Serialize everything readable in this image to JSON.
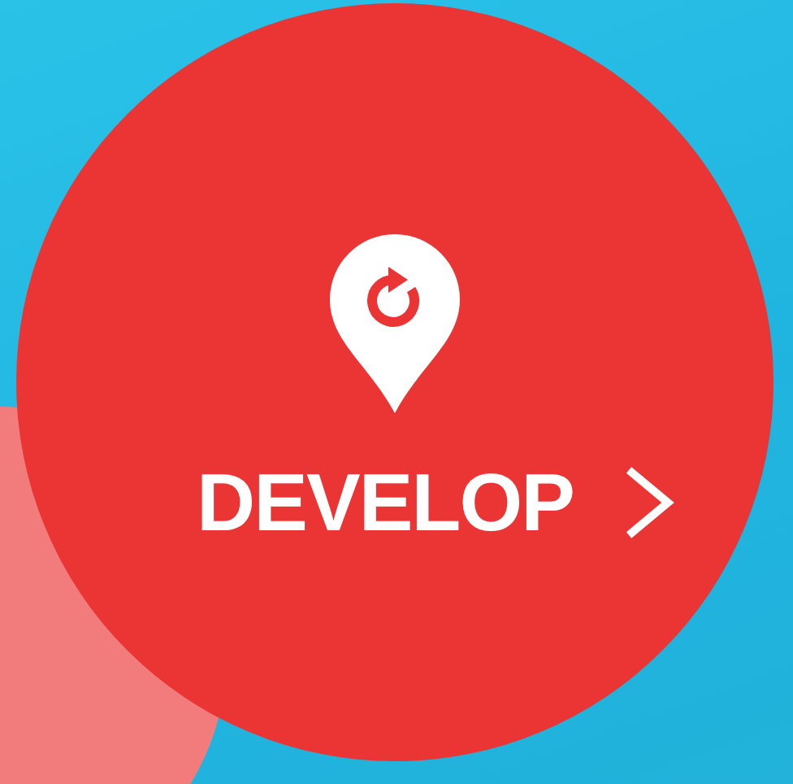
{
  "button": {
    "label": "DEVELOP"
  }
}
